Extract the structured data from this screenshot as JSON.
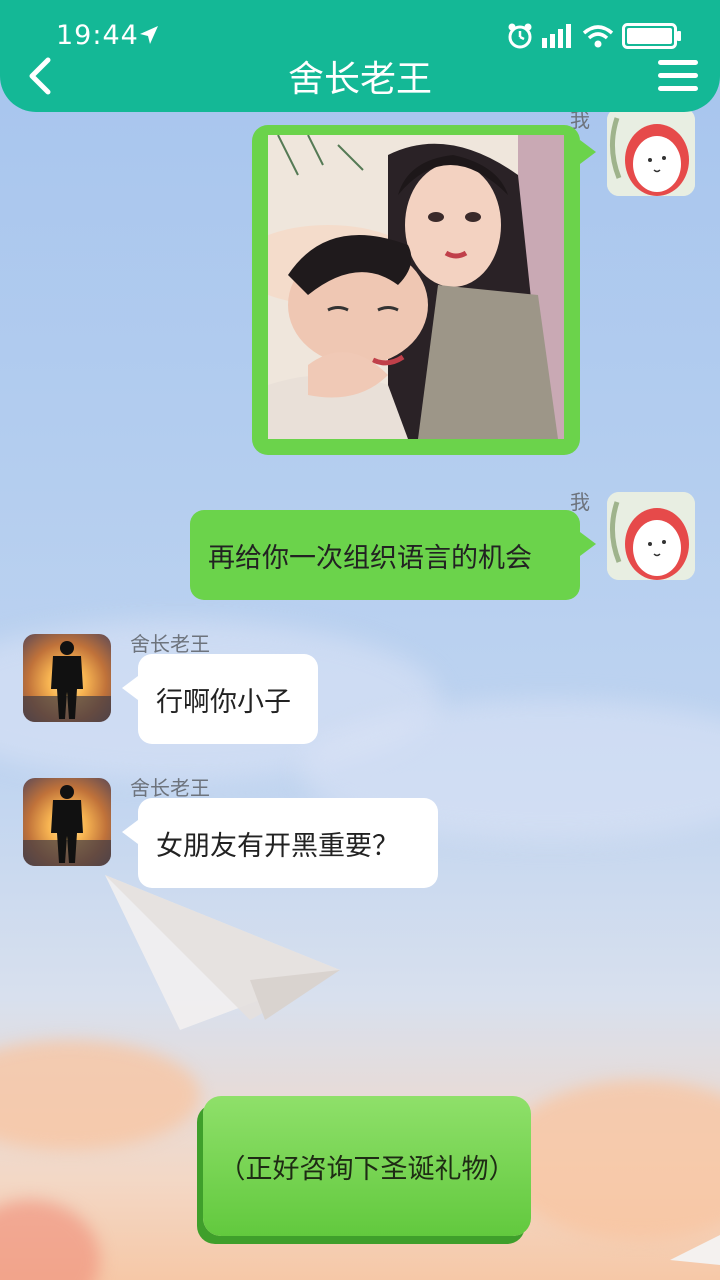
{
  "status_bar": {
    "time": "19:44"
  },
  "header": {
    "title": "舍长老王"
  },
  "messages": [
    {
      "sender": "我",
      "type": "image"
    },
    {
      "sender": "我",
      "text": "再给你一次组织语言的机会"
    },
    {
      "sender": "舍长老王",
      "text": "行啊你小子"
    },
    {
      "sender": "舍长老王",
      "text": "女朋友有开黑重要？"
    }
  ],
  "composer": {
    "text": "（正好咨询下圣诞礼物）"
  },
  "colors": {
    "header": "#14b896",
    "my_bubble": "#6bd34b",
    "their_bubble": "#ffffff"
  }
}
